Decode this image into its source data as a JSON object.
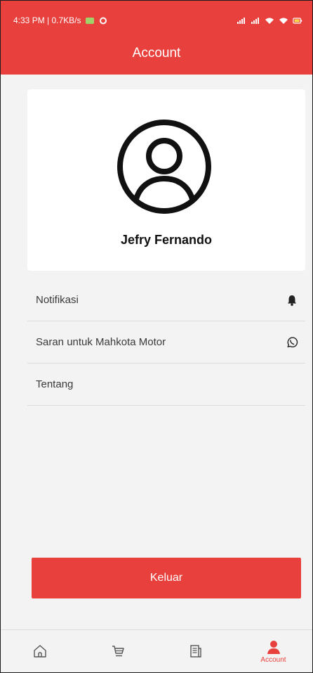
{
  "status_bar": {
    "time_info": "4:33 PM | 0.7KB/s"
  },
  "header": {
    "title": "Account"
  },
  "profile": {
    "name": "Jefry Fernando"
  },
  "menu": {
    "items": [
      {
        "label": "Notifikasi",
        "icon": "bell-icon"
      },
      {
        "label": "Saran untuk Mahkota Motor",
        "icon": "whatsapp-icon"
      },
      {
        "label": "Tentang",
        "icon": ""
      }
    ]
  },
  "logout": {
    "label": "Keluar"
  },
  "bottom_nav": {
    "items": [
      {
        "icon": "home-icon",
        "label": ""
      },
      {
        "icon": "cart-icon",
        "label": ""
      },
      {
        "icon": "news-icon",
        "label": ""
      },
      {
        "icon": "person-icon",
        "label": "Account",
        "active": true
      }
    ]
  },
  "colors": {
    "accent": "#e8413d",
    "background": "#f3f3f3"
  }
}
